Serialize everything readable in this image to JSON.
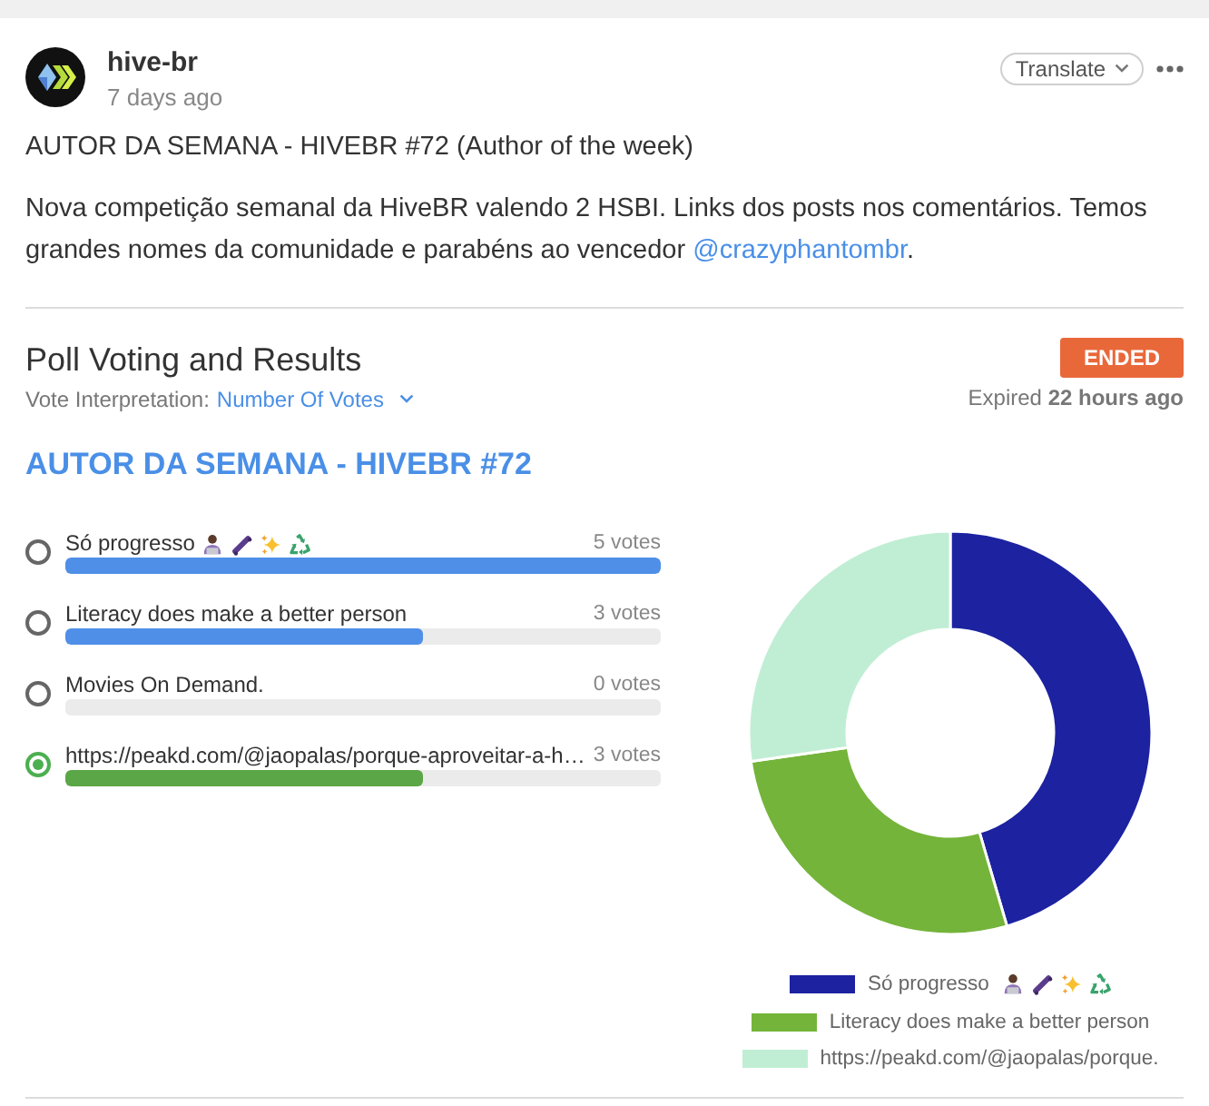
{
  "post": {
    "author": "hive-br",
    "time": "7 days ago",
    "translate_button": "Translate",
    "title": "AUTOR DA SEMANA - HIVEBR #72 (Author of the week)",
    "body": [
      {
        "kind": "text",
        "text": "Nova competição semanal da HiveBR valendo 2 HSBI. Links dos posts nos comentários. Temos grandes nomes da comunidade e parabéns ao vencedor "
      },
      {
        "kind": "link",
        "text": "@crazyphantombr"
      },
      {
        "kind": "text",
        "text": "."
      }
    ]
  },
  "poll": {
    "heading": "Poll Voting and Results",
    "status": "ENDED",
    "interpretation_label": "Vote Interpretation:",
    "interpretation": "Number Of Votes",
    "expired": "Expired **22 hours ago**",
    "title": "AUTOR DA SEMANA - HIVEBR #72",
    "options": [
      {
        "kind": "emoji",
        "label": "Só progresso",
        "votes": "5 votes",
        "level": 1,
        "selected": false
      },
      {
        "kind": "text",
        "label": "Literacy does make a better person",
        "votes": "3 votes",
        "level": 0.6,
        "selected": false
      },
      {
        "kind": "text",
        "label": "Movies On Demand.",
        "votes": "0 votes",
        "level": 0,
        "selected": false
      },
      {
        "kind": "text",
        "label": "https://peakd.com/@jaopalas/porque-aproveitar-a-h…",
        "votes": "3 votes",
        "level": 0.6,
        "selected": true
      }
    ],
    "chart": {
      "chart_data": {
        "type": "donut",
        "categories": [
          "Só progresso",
          "Literacy does make a better person",
          "https://peakd.com/@jaopalas/porque."
        ],
        "values": [
          45.46,
          27.27,
          27.27
        ],
        "legend": "bottom"
      },
      "slices": [
        {
          "color": "#1c22a0",
          "kind": "emoji"
        },
        {
          "color": "#74b43a",
          "kind": "text"
        },
        {
          "color": "#c0eed4",
          "kind": "text"
        }
      ]
    }
  }
}
